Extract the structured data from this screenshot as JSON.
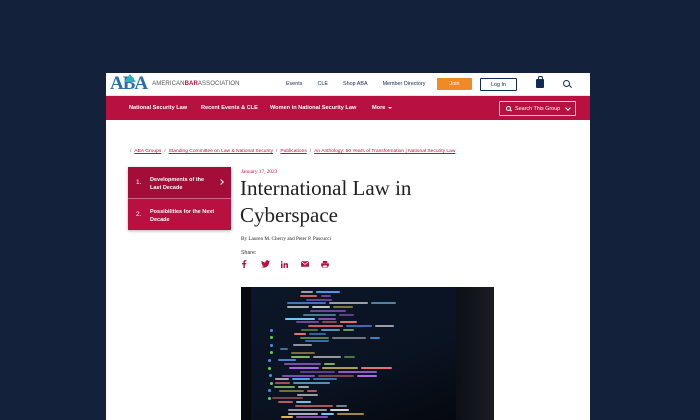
{
  "header": {
    "logo_mark": "ABA",
    "logo_text_prefix": "AMERICAN",
    "logo_text_bold": "BAR",
    "logo_text_suffix": "ASSOCIATION",
    "links": [
      "Events",
      "CLE",
      "Shop ABA",
      "Member Directory"
    ],
    "join_label": "Join",
    "login_label": "Log In"
  },
  "nav": {
    "items": [
      "National Security Law",
      "Recent Events & CLE",
      "Women in National Security Law"
    ],
    "more_label": "More",
    "search_placeholder": "Search This Group"
  },
  "breadcrumb": [
    "ABA Groups",
    "Standing Committee on Law & National Security",
    "Publications",
    "An Anthology: 60 Years of Transformation | National Security Law"
  ],
  "sidebar": {
    "items": [
      {
        "num": "1.",
        "label": "Developments of the Last Decade"
      },
      {
        "num": "2.",
        "label": "Possibilities for the Next Decade"
      }
    ]
  },
  "article": {
    "date": "January 17, 2023",
    "title": "International Law in Cyberspace",
    "byline": "By Lauren M. Cherry and Peter P. Pascucci",
    "share_label": "Share:"
  },
  "share_icons": [
    "facebook-icon",
    "twitter-icon",
    "linkedin-icon",
    "email-icon",
    "print-icon"
  ],
  "colors": {
    "background": "#13213a",
    "brand_red": "#b8113f",
    "join_orange": "#f08a24",
    "navy": "#0e2a55"
  }
}
